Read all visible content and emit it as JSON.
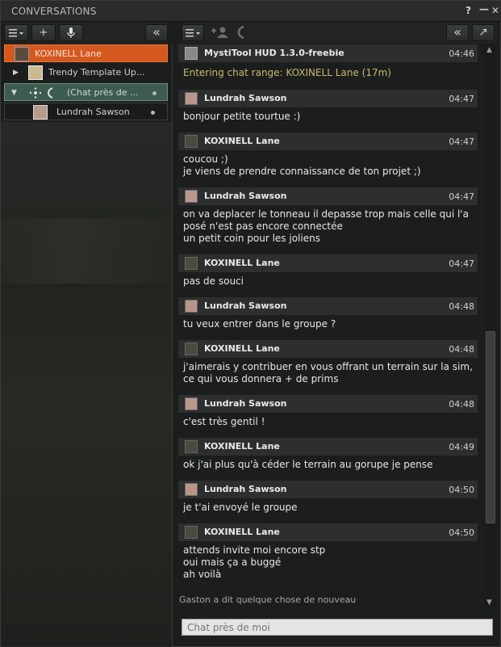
{
  "window": {
    "title": "CONVERSATIONS",
    "help_label": "?",
    "minimize_label": "—",
    "close_label": "✕"
  },
  "left_toolbar": {
    "add_label": "+",
    "collapse_label": "«"
  },
  "right_toolbar": {
    "collapse_label": "«",
    "tearoff_label": "↗"
  },
  "conversations": {
    "selected": "KOXINELL Lane",
    "trendy": "Trendy Template Up...",
    "nearby": "(Chat près de ...",
    "lundrah": "Lundrah Sawson"
  },
  "chat": {
    "object_name": "MystiTool HUD 1.3.0-freebie",
    "object_time": "04:46",
    "system_line": "Entering chat range: KOXINELL Lane (17m)",
    "messages": [
      {
        "name": "Lundrah Sawson",
        "time": "04:47",
        "lines": [
          "bonjour petite tourtue :)"
        ]
      },
      {
        "name": "KOXINELL Lane",
        "time": "04:47",
        "lines": [
          "coucou ;)",
          "je viens de prendre connaissance de ton projet ;)"
        ]
      },
      {
        "name": "Lundrah Sawson",
        "time": "04:47",
        "lines": [
          "on va deplacer le tonneau il depasse trop mais celle qui l'a",
          "posé n'est pas encore connectée",
          "un petit coin pour les joliens"
        ]
      },
      {
        "name": "KOXINELL Lane",
        "time": "04:47",
        "lines": [
          "pas de souci"
        ]
      },
      {
        "name": "Lundrah Sawson",
        "time": "04:48",
        "lines": [
          "tu veux entrer dans le groupe ?"
        ]
      },
      {
        "name": "KOXINELL Lane",
        "time": "04:48",
        "lines": [
          "j'aimerais y contribuer en vous offrant un terrain sur la sim,",
          "ce qui vous donnera + de prims"
        ]
      },
      {
        "name": "Lundrah Sawson",
        "time": "04:48",
        "lines": [
          "c'est très gentil !"
        ]
      },
      {
        "name": "KOXINELL Lane",
        "time": "04:49",
        "lines": [
          "ok j'ai plus qu'à céder le terrain au gorupe je pense"
        ]
      },
      {
        "name": "Lundrah Sawson",
        "time": "04:50",
        "lines": [
          "je t'ai envoyé le groupe"
        ]
      },
      {
        "name": "KOXINELL Lane",
        "time": "04:50",
        "lines": [
          "attends invite moi encore stp",
          "oui mais ça a buggé",
          "ah voilà"
        ]
      }
    ],
    "notice": "Gaston a dit quelque chose de nouveau"
  },
  "input": {
    "placeholder": "Chat près de moi"
  },
  "colors": {
    "selected_bg": "#d5581f",
    "group_bg": "#3e5b4f",
    "system_text": "#c8b970"
  }
}
